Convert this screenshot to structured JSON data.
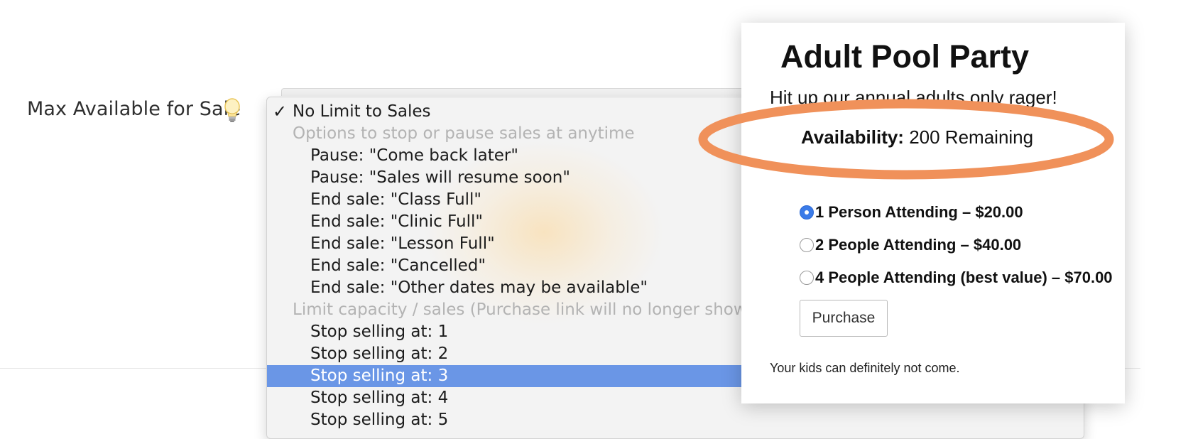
{
  "form": {
    "label": "Max Available for Sale",
    "hint_icon": "lightbulb-icon"
  },
  "dropdown": {
    "options": [
      {
        "label": "No Limit to Sales",
        "checked": true
      },
      {
        "label": "Options to stop or pause sales at anytime",
        "group": true
      },
      {
        "label": "Pause: \"Come back later\""
      },
      {
        "label": "Pause: \"Sales will resume soon\""
      },
      {
        "label": "End sale: \"Class Full\""
      },
      {
        "label": "End sale: \"Clinic Full\""
      },
      {
        "label": "End sale: \"Lesson Full\""
      },
      {
        "label": "End sale: \"Cancelled\""
      },
      {
        "label": "End sale: \"Other dates may be available\""
      },
      {
        "label": "Limit capacity / sales (Purchase link will no longer show on gr",
        "group": true
      },
      {
        "label": "Stop selling at: 1"
      },
      {
        "label": "Stop selling at: 2"
      },
      {
        "label": "Stop selling at: 3",
        "highlighted": true
      },
      {
        "label": "Stop selling at: 4"
      },
      {
        "label": "Stop selling at: 5"
      }
    ],
    "highlight_color": "#6a96e6",
    "check_mark": "✓"
  },
  "card": {
    "title": "Adult Pool Party",
    "subtitle": "Hit up our annual adults only rager!",
    "availability_label": "Availability:",
    "availability_value": "200 Remaining",
    "annotation_color": "#f0915a",
    "options": [
      {
        "label": "1 Person Attending – $20.00",
        "checked": true
      },
      {
        "label": "2 People Attending – $40.00",
        "checked": false
      },
      {
        "label": "4 People Attending (best value) – $70.00",
        "checked": false
      }
    ],
    "purchase_label": "Purchase",
    "note": "Your kids can definitely not come."
  }
}
